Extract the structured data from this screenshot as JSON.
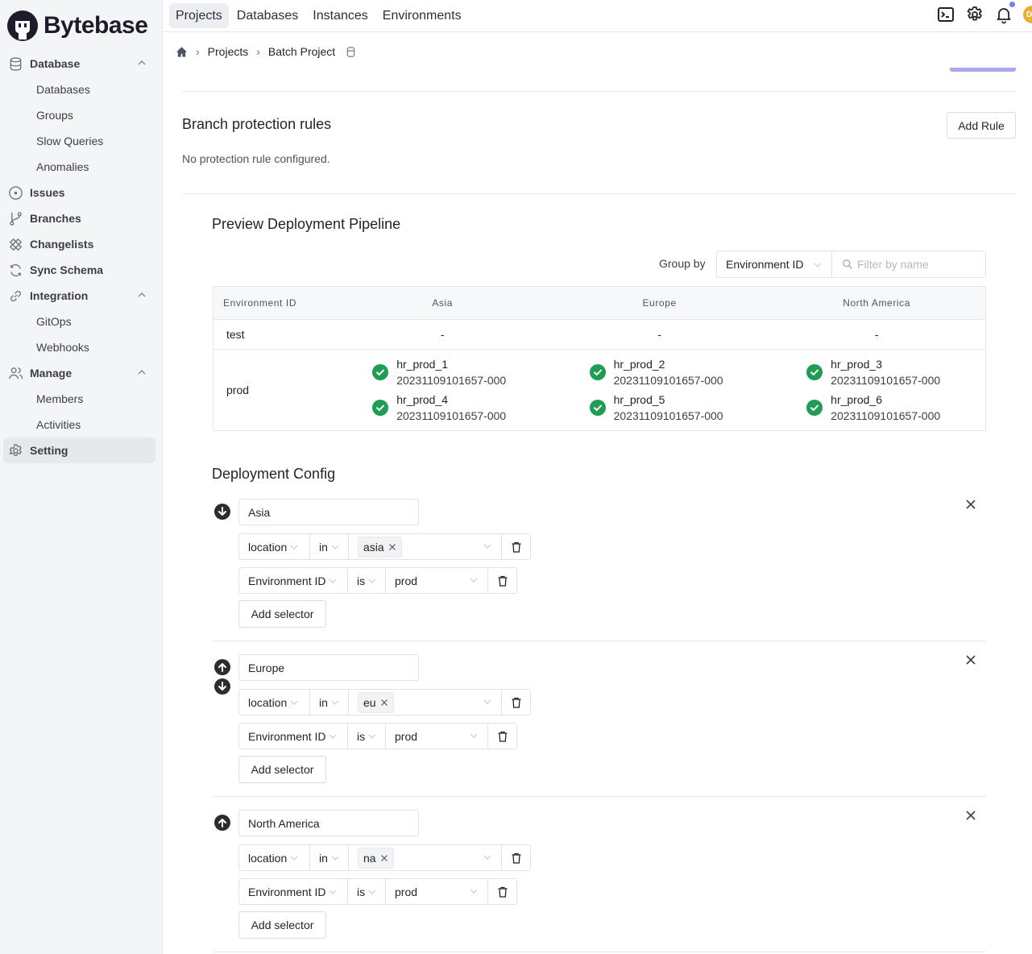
{
  "app": {
    "name": "Bytebase"
  },
  "sidebar": {
    "items": [
      {
        "label": "Database",
        "icon": "database-icon",
        "type": "group",
        "expanded": true
      },
      {
        "label": "Databases",
        "type": "sub"
      },
      {
        "label": "Groups",
        "type": "sub"
      },
      {
        "label": "Slow Queries",
        "type": "sub"
      },
      {
        "label": "Anomalies",
        "type": "sub"
      },
      {
        "label": "Issues",
        "icon": "issues-icon",
        "type": "top"
      },
      {
        "label": "Branches",
        "icon": "branch-icon",
        "type": "top"
      },
      {
        "label": "Changelists",
        "icon": "changelist-icon",
        "type": "top"
      },
      {
        "label": "Sync Schema",
        "icon": "sync-icon",
        "type": "top"
      },
      {
        "label": "Integration",
        "icon": "link-icon",
        "type": "group",
        "expanded": true
      },
      {
        "label": "GitOps",
        "type": "sub"
      },
      {
        "label": "Webhooks",
        "type": "sub"
      },
      {
        "label": "Manage",
        "icon": "users-icon",
        "type": "group",
        "expanded": true
      },
      {
        "label": "Members",
        "type": "sub"
      },
      {
        "label": "Activities",
        "type": "sub"
      },
      {
        "label": "Setting",
        "icon": "gear-icon",
        "type": "top",
        "active": true
      }
    ]
  },
  "topnav": {
    "items": [
      "Projects",
      "Databases",
      "Instances",
      "Environments"
    ],
    "active": "Projects",
    "avatar_initials": "DE"
  },
  "breadcrumb": {
    "items": [
      "Projects",
      "Batch Project"
    ]
  },
  "branch_protection": {
    "title": "Branch protection rules",
    "add_rule_label": "Add Rule",
    "empty_text": "No protection rule configured."
  },
  "pipeline": {
    "title": "Preview Deployment Pipeline",
    "group_by_label": "Group by",
    "group_by_value": "Environment ID",
    "filter_placeholder": "Filter by name",
    "columns": [
      "Environment ID",
      "Asia",
      "Europe",
      "North America"
    ],
    "rows": [
      {
        "env": "test",
        "cells": [
          "-",
          "-",
          "-"
        ]
      },
      {
        "env": "prod",
        "cells": [
          [
            {
              "name": "hr_prod_1",
              "version": "20231109101657-000",
              "status": "success"
            },
            {
              "name": "hr_prod_4",
              "version": "20231109101657-000",
              "status": "success"
            }
          ],
          [
            {
              "name": "hr_prod_2",
              "version": "20231109101657-000",
              "status": "success"
            },
            {
              "name": "hr_prod_5",
              "version": "20231109101657-000",
              "status": "success"
            }
          ],
          [
            {
              "name": "hr_prod_3",
              "version": "20231109101657-000",
              "status": "success"
            },
            {
              "name": "hr_prod_6",
              "version": "20231109101657-000",
              "status": "success"
            }
          ]
        ]
      }
    ]
  },
  "deployment_config": {
    "title": "Deployment Config",
    "add_selector_label": "Add selector",
    "stages": [
      {
        "name": "Asia",
        "can_move_up": false,
        "can_move_down": true,
        "selectors": [
          {
            "key": "location",
            "operator": "in",
            "values": [
              "asia"
            ]
          },
          {
            "key": "Environment ID",
            "operator": "is",
            "value": "prod"
          }
        ]
      },
      {
        "name": "Europe",
        "can_move_up": true,
        "can_move_down": true,
        "selectors": [
          {
            "key": "location",
            "operator": "in",
            "values": [
              "eu"
            ]
          },
          {
            "key": "Environment ID",
            "operator": "is",
            "value": "prod"
          }
        ]
      },
      {
        "name": "North America",
        "can_move_up": true,
        "can_move_down": false,
        "selectors": [
          {
            "key": "location",
            "operator": "in",
            "values": [
              "na"
            ]
          },
          {
            "key": "Environment ID",
            "operator": "is",
            "value": "prod"
          }
        ]
      }
    ]
  },
  "colors": {
    "success": "#1f9d55",
    "accent": "#a8a9ec",
    "avatar": "#e6b033",
    "notification_dot": "#7c7ee8"
  }
}
